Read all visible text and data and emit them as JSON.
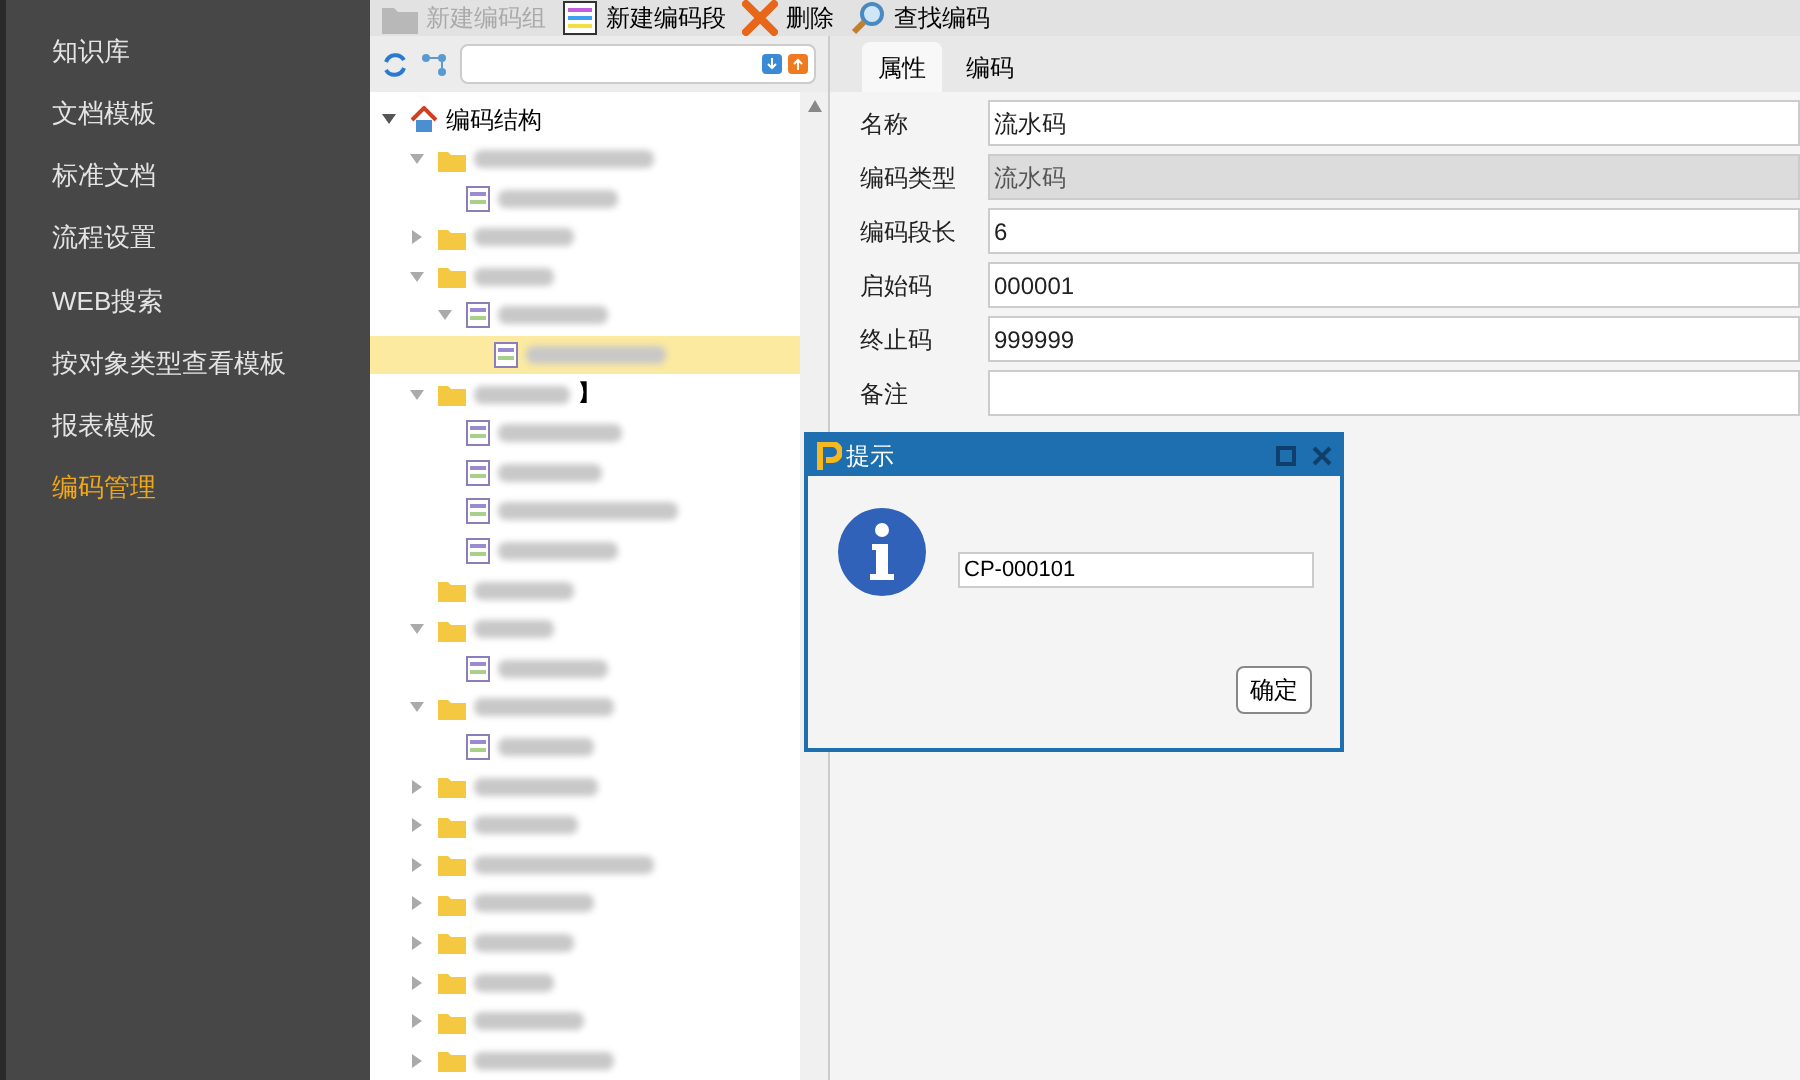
{
  "sidebar": {
    "items": [
      {
        "label": "知识库",
        "selected": false
      },
      {
        "label": "文档模板",
        "selected": false
      },
      {
        "label": "标准文档",
        "selected": false
      },
      {
        "label": "流程设置",
        "selected": false
      },
      {
        "label": "WEB搜索",
        "selected": false
      },
      {
        "label": "按对象类型查看模板",
        "selected": false
      },
      {
        "label": "报表模板",
        "selected": false
      },
      {
        "label": "编码管理",
        "selected": true
      }
    ]
  },
  "toolbar": [
    {
      "kind": "group",
      "label": "新建编码组",
      "disabled": true
    },
    {
      "kind": "segment",
      "label": "新建编码段",
      "disabled": false
    },
    {
      "kind": "delete",
      "label": "删除",
      "disabled": false
    },
    {
      "kind": "find",
      "label": "查找编码",
      "disabled": false
    }
  ],
  "tree": {
    "root": {
      "label": "编码结构",
      "expanded": true
    },
    "children": [
      {
        "kind": "folder",
        "expanded": true,
        "selected": false,
        "children": [
          {
            "kind": "leaf",
            "selected": false
          }
        ]
      },
      {
        "kind": "folder",
        "expanded": false,
        "selected": false
      },
      {
        "kind": "folder",
        "expanded": true,
        "selected": false,
        "children": [
          {
            "kind": "leaf",
            "expanded": true,
            "selected": false,
            "children": [
              {
                "kind": "leaf",
                "selected": true
              }
            ]
          }
        ]
      },
      {
        "kind": "folder",
        "expanded": true,
        "selected": false,
        "visible_text": "】",
        "children": [
          {
            "kind": "leaf",
            "selected": false
          },
          {
            "kind": "leaf",
            "selected": false
          },
          {
            "kind": "leaf",
            "selected": false
          },
          {
            "kind": "leaf",
            "selected": false
          }
        ]
      },
      {
        "kind": "folder",
        "selected": false
      },
      {
        "kind": "folder",
        "expanded": true,
        "selected": false,
        "children": [
          {
            "kind": "leaf",
            "selected": false
          }
        ]
      },
      {
        "kind": "folder",
        "expanded": true,
        "selected": false,
        "children": [
          {
            "kind": "leaf",
            "selected": false
          }
        ]
      },
      {
        "kind": "folder",
        "expanded": false,
        "selected": false
      },
      {
        "kind": "folder",
        "expanded": false,
        "selected": false
      },
      {
        "kind": "folder",
        "expanded": false,
        "selected": false
      },
      {
        "kind": "folder",
        "expanded": false,
        "selected": false
      },
      {
        "kind": "folder",
        "expanded": false,
        "selected": false
      },
      {
        "kind": "folder",
        "expanded": false,
        "selected": false
      },
      {
        "kind": "folder",
        "expanded": false,
        "selected": false
      },
      {
        "kind": "folder",
        "expanded": false,
        "selected": false
      }
    ]
  },
  "tabs": [
    {
      "label": "属性",
      "selected": true
    },
    {
      "label": "编码",
      "selected": false
    }
  ],
  "form": [
    {
      "label": "名称",
      "value": "流水码",
      "readonly": false
    },
    {
      "label": "编码类型",
      "value": "流水码",
      "readonly": true
    },
    {
      "label": "编码段长",
      "value": "6",
      "readonly": false
    },
    {
      "label": "启始码",
      "value": "000001",
      "readonly": false
    },
    {
      "label": "终止码",
      "value": "999999",
      "readonly": false
    },
    {
      "label": "备注",
      "readonly": false
    }
  ],
  "dialog": {
    "title": "提示",
    "value": "CP-000101",
    "button": "确定"
  }
}
